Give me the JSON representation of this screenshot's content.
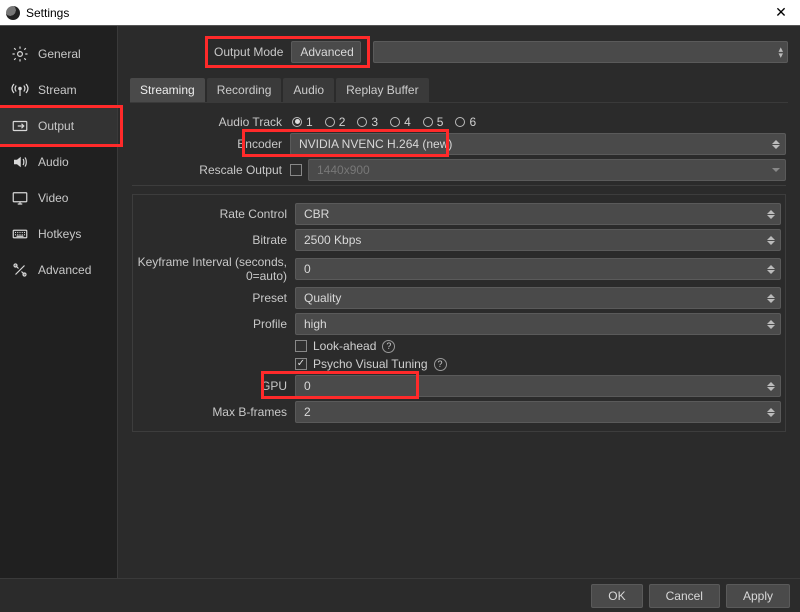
{
  "window": {
    "title": "Settings",
    "close": "✕"
  },
  "sidebar": {
    "items": [
      {
        "label": "General",
        "icon": "gear-icon"
      },
      {
        "label": "Stream",
        "icon": "antenna-icon"
      },
      {
        "label": "Output",
        "icon": "output-icon"
      },
      {
        "label": "Audio",
        "icon": "speaker-icon"
      },
      {
        "label": "Video",
        "icon": "monitor-icon"
      },
      {
        "label": "Hotkeys",
        "icon": "keyboard-icon"
      },
      {
        "label": "Advanced",
        "icon": "tools-icon"
      }
    ],
    "active_index": 2
  },
  "output_mode": {
    "label": "Output Mode",
    "value": "Advanced"
  },
  "tabs": {
    "items": [
      "Streaming",
      "Recording",
      "Audio",
      "Replay Buffer"
    ],
    "active_index": 0
  },
  "audio_track": {
    "label": "Audio Track",
    "options": [
      "1",
      "2",
      "3",
      "4",
      "5",
      "6"
    ],
    "selected": "1"
  },
  "encoder": {
    "label": "Encoder",
    "value": "NVIDIA NVENC H.264 (new)"
  },
  "rescale": {
    "label": "Rescale Output",
    "checked": false,
    "value": "1440x900"
  },
  "rate_control": {
    "label": "Rate Control",
    "value": "CBR"
  },
  "bitrate": {
    "label": "Bitrate",
    "value": "2500 Kbps"
  },
  "keyframe": {
    "label": "Keyframe Interval (seconds, 0=auto)",
    "value": "0"
  },
  "preset": {
    "label": "Preset",
    "value": "Quality"
  },
  "profile": {
    "label": "Profile",
    "value": "high"
  },
  "lookahead": {
    "label": "Look-ahead",
    "checked": false
  },
  "psycho": {
    "label": "Psycho Visual Tuning",
    "checked": true
  },
  "gpu": {
    "label": "GPU",
    "value": "0"
  },
  "max_bframes": {
    "label": "Max B-frames",
    "value": "2"
  },
  "footer": {
    "ok": "OK",
    "cancel": "Cancel",
    "apply": "Apply"
  }
}
